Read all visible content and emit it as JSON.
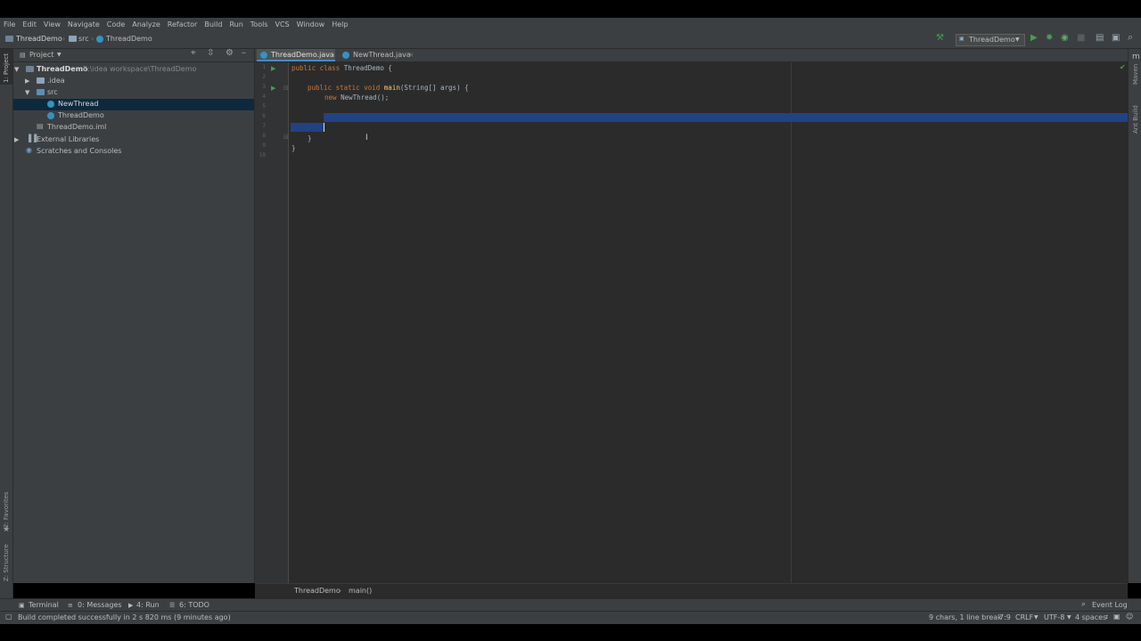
{
  "menu": [
    "File",
    "Edit",
    "View",
    "Navigate",
    "Code",
    "Analyze",
    "Refactor",
    "Build",
    "Run",
    "Tools",
    "VCS",
    "Window",
    "Help"
  ],
  "nav": {
    "project": "ThreadDemo",
    "src": "src",
    "file": "ThreadDemo"
  },
  "run_config": "ThreadDemo",
  "project_panel": {
    "title": "Project",
    "tree": {
      "root_name": "ThreadDemo",
      "root_path": "E:\\idea workspace\\ThreadDemo",
      "idea": ".idea",
      "src": "src",
      "newthread": "NewThread",
      "threaddemo": "ThreadDemo",
      "iml": "ThreadDemo.iml",
      "extlib": "External Libraries",
      "scratches": "Scratches and Consoles"
    }
  },
  "side_tabs": {
    "project": "1: Project",
    "favorites": "2: Favorites",
    "structure": "Z: Structure",
    "maven": "Maven",
    "ant": "Ant Build"
  },
  "tabs": [
    {
      "label": "ThreadDemo.java",
      "active": true
    },
    {
      "label": "NewThread.java",
      "active": false
    }
  ],
  "code": {
    "line_numbers": [
      "1",
      "2",
      "3",
      "4",
      "5",
      "6",
      "7",
      "8",
      "9",
      "10"
    ],
    "l1_kw": "public class ",
    "l1_rest": "ThreadDemo {",
    "l3_kw": "public static void ",
    "l3_fn": "main",
    "l3_rest": "(String[] args) {",
    "l4_kw": "new ",
    "l4_rest": "NewThread();",
    "l8": "}",
    "l9": "}"
  },
  "breadcrumbs": {
    "cls": "ThreadDemo",
    "method": "main()"
  },
  "toolwindows": {
    "terminal": "Terminal",
    "messages": "0: Messages",
    "run": "4: Run",
    "todo": "6: TODO",
    "eventlog": "Event Log"
  },
  "status": {
    "message": "Build completed successfully in 2 s 820 ms (9 minutes ago)",
    "selection": "9 chars, 1 line break",
    "position": "7:9",
    "line_sep": "CRLF",
    "encoding": "UTF-8",
    "indent": "4 spaces"
  },
  "colors": {
    "accent": "#3592c4",
    "selection": "#214283",
    "keyword": "#cc7832",
    "function": "#ffc66d",
    "run_green": "#499c54"
  }
}
